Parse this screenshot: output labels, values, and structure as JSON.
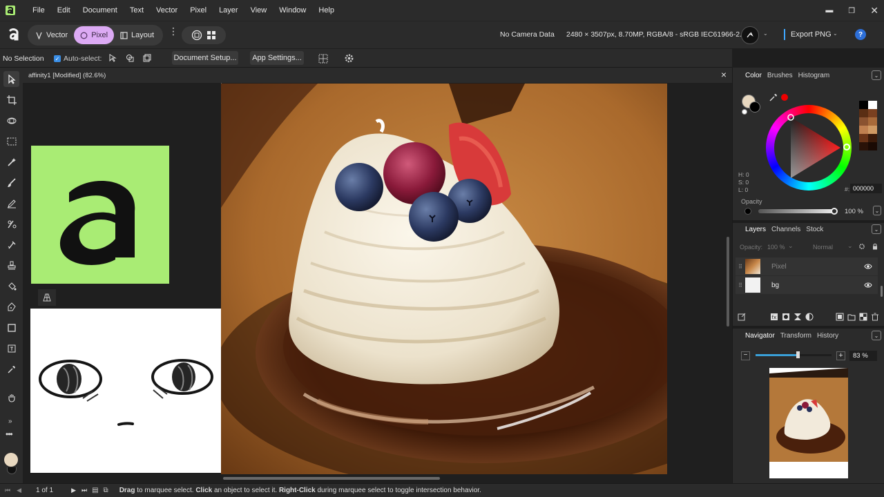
{
  "menu": [
    "File",
    "Edit",
    "Document",
    "Text",
    "Vector",
    "Pixel",
    "Layer",
    "View",
    "Window",
    "Help"
  ],
  "personas": {
    "vector": "Vector",
    "pixel": "Pixel",
    "layout": "Layout"
  },
  "toolbar": {
    "camera": "No Camera Data",
    "doc_info": "2480 × 3507px, 8.70MP, RGBA/8 - sRGB IEC61966-2.1",
    "export_label": "Export PNG",
    "help": "?"
  },
  "context": {
    "selection": "No Selection",
    "autoselect": "Auto-select:",
    "doc_setup": "Document Setup...",
    "app_settings": "App Settings..."
  },
  "document": {
    "tab_title": "affinity1 [Modified] (82.6%)",
    "close": "×"
  },
  "color_panel": {
    "tabs": [
      "Color",
      "Brushes",
      "Histogram"
    ],
    "h": "H: 0",
    "s": "S: 0",
    "l": "L: 0",
    "hex": "000000",
    "hex_prefix": "#:",
    "opacity_label": "Opacity",
    "opacity_value": "100 %",
    "primary_color": "#e8d8c0",
    "swatches": [
      "#000000",
      "#ffffff",
      "#5a2e14",
      "#7a4020",
      "#8a5230",
      "#a86a3a",
      "#c08050",
      "#d09a64",
      "#6a3418",
      "#3a1a0a",
      "#2a1208",
      "#1a0a04"
    ]
  },
  "layers_panel": {
    "tabs": [
      "Layers",
      "Channels",
      "Stock"
    ],
    "opacity": "Opacity:",
    "opacity_value": "100 %",
    "blend": "Normal",
    "layers": [
      {
        "name": "Pixel"
      },
      {
        "name": "bg"
      }
    ]
  },
  "navigator": {
    "tabs": [
      "Navigator",
      "Transform",
      "History"
    ],
    "zoom": "83 %",
    "zoom_level": 0.55
  },
  "status": {
    "page": "1 of 1",
    "hint_drag": "Drag",
    "hint1": " to marquee select. ",
    "hint_click": "Click",
    "hint2": " an object to select it. ",
    "hint_right": "Right-Click",
    "hint3": " during marquee select to toggle intersection behavior."
  }
}
